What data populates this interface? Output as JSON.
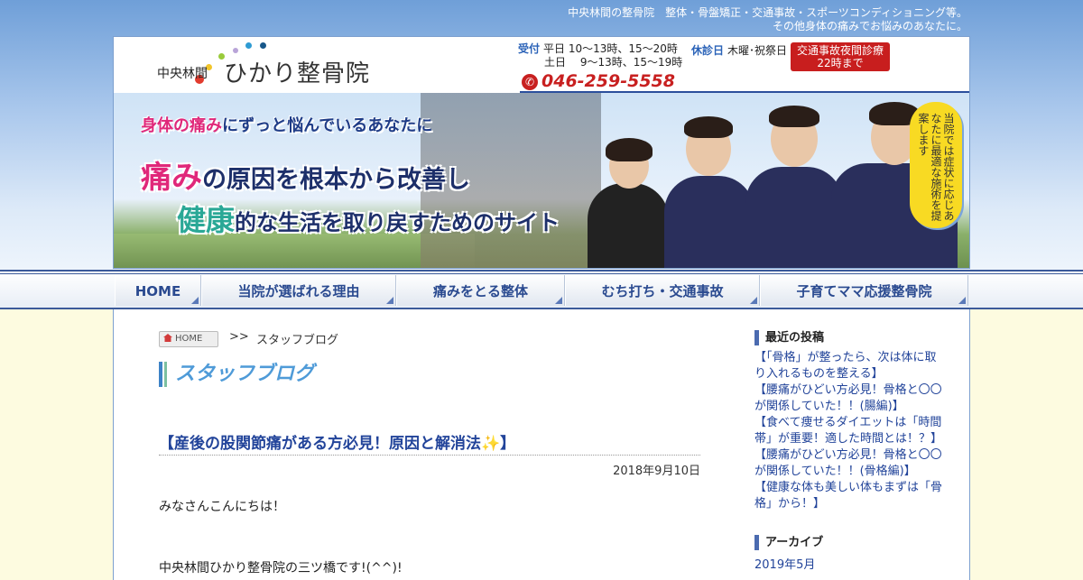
{
  "tagline": {
    "line1": "中央林間の整骨院　整体・骨盤矯正・交通事故・スポーツコンディショニング等。",
    "line2": "その他身体の痛みでお悩みのあなたに。"
  },
  "logo": {
    "sub": "中央林間",
    "main": "ひかり整骨院"
  },
  "hours": {
    "label": "受付",
    "weekday": "平日 10～13時、15～20時",
    "weekend": "土日 　9～13時、15～19時",
    "closed_label": "休診日",
    "closed_value": "木曜･祝祭日"
  },
  "phone": {
    "icon": "phone-icon",
    "number": "046-259-5558"
  },
  "night_badge": {
    "line1": "交通事故夜間診療",
    "line2": "22時まで"
  },
  "hero": {
    "line1_pink": "身体の痛み",
    "line1_rest": "にずっと悩んでいるあなたに",
    "line2_pink": "痛み",
    "line2_rest": "の原因を根本から改善し",
    "line3_green": "健康",
    "line3_rest": "的な生活を取り戻すためのサイト",
    "bubble": "当院では症状に応じあなたに最適な施術を提案します"
  },
  "nav": [
    {
      "label": "HOME"
    },
    {
      "label": "当院が選ばれる理由"
    },
    {
      "label": "痛みをとる整体"
    },
    {
      "label": "むち打ち・交通事故"
    },
    {
      "label": "子育てママ応援整骨院"
    }
  ],
  "breadcrumb": {
    "home": "HOME",
    "sep": ">>",
    "current": "スタッフブログ"
  },
  "page_title": "スタッフブログ",
  "post": {
    "title": "【産後の股関節痛がある方必見！原因と解消法✨】",
    "date": "2018年9月10日",
    "body1": "みなさんこんにちは！",
    "body2": "中央林間ひかり整骨院の三ツ橋です!(^^)!"
  },
  "sidebar": {
    "recent_title": "最近の投稿",
    "recent": [
      "【「骨格」が整ったら、次は体に取り入れるものを整える】",
      "【腰痛がひどい方必見！骨格と〇〇が関係していた！！(腸編)】",
      "【食べて痩せるダイエットは「時間帯」が重要！適した時間とは！？】",
      "【腰痛がひどい方必見！骨格と〇〇が関係していた！！(骨格編)】",
      "【健康な体も美しい体もまずは「骨格」から！】"
    ],
    "archive_title": "アーカイブ",
    "archive_first": "2019年5月"
  },
  "colors": {
    "accent_blue": "#2b4f9c",
    "brand_pink": "#e0287a",
    "brand_green": "#2aa896",
    "alert_red": "#c81e1e",
    "bubble_yellow": "#f8da23"
  }
}
